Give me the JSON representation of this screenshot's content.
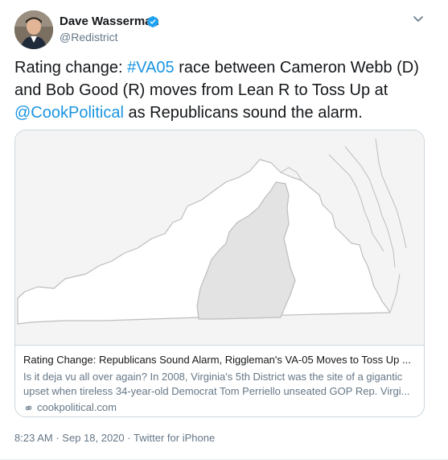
{
  "author": {
    "name": "Dave Wasserman",
    "handle": "@Redistrict",
    "verified": true
  },
  "tweet": {
    "text_1": "Rating change: ",
    "hashtag": "#VA05",
    "text_2": " race between Cameron Webb (D) and Bob Good (R) moves from Lean R to Toss Up at ",
    "mention": "@CookPolitical",
    "text_3": " as Republicans sound the alarm."
  },
  "card": {
    "title": "Rating Change: Republicans Sound Alarm, Riggleman's VA-05 Moves to Toss Up ...",
    "description": "Is it deja vu all over again? In 2008, Virginia's 5th District was the site of a gigantic upset when tireless 34-year-old Democrat Tom Perriello unseated GOP Rep. Virgi...",
    "domain": "cookpolitical.com",
    "map_colors": {
      "state": "#ffffff",
      "district": "#e3e3e3",
      "border": "#bdbdbd"
    }
  },
  "meta": {
    "time": "8:23 AM",
    "separator": "·",
    "date": "Sep 18, 2020",
    "source": "Twitter for iPhone"
  },
  "icons": {
    "verified": "verified-badge-icon",
    "caret": "chevron-down-icon",
    "link": "link-icon"
  },
  "colors": {
    "link": "#1b95e0",
    "secondary": "#657786",
    "verified": "#1da1f2"
  }
}
